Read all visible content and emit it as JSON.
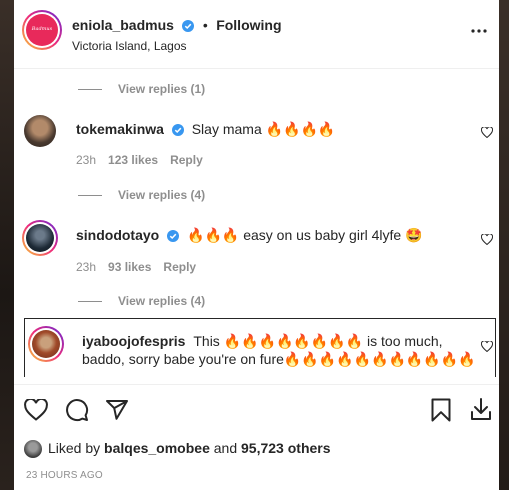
{
  "post": {
    "username": "eniola_badmus",
    "separator": "•",
    "follow_status": "Following",
    "location": "Victoria Island, Lagos",
    "avatar_text": "Badmus"
  },
  "replies": [
    {
      "label": "View replies (1)"
    },
    {
      "label": "View replies (4)"
    },
    {
      "label": "View replies (4)"
    }
  ],
  "comments": [
    {
      "username": "tokemakinwa",
      "text": "Slay mama 🔥🔥🔥🔥",
      "time": "23h",
      "likes": "123 likes",
      "reply": "Reply"
    },
    {
      "username": "sindodotayo",
      "text": "🔥🔥🔥 easy on us baby girl 4lyfe 🤩",
      "time": "23h",
      "likes": "93 likes",
      "reply": "Reply"
    },
    {
      "username": "iyaboojofespris",
      "text": "This 🔥🔥🔥🔥🔥🔥🔥🔥 is too much, baddo, sorry babe you're on fure🔥🔥🔥🔥🔥🔥🔥🔥🔥🔥🔥"
    }
  ],
  "likes": {
    "prefix": "Liked by ",
    "user": "balqes_omobee",
    "middle": " and ",
    "count": "95,723 others"
  },
  "time_ago": "23 HOURS AGO",
  "colors": {
    "verified": "#3897f0",
    "brand_avatar": "#e8295b"
  },
  "icons": [
    "more-options-icon",
    "heart-icon",
    "comment-icon",
    "share-icon",
    "bookmark-icon",
    "download-icon",
    "verified-icon"
  ]
}
